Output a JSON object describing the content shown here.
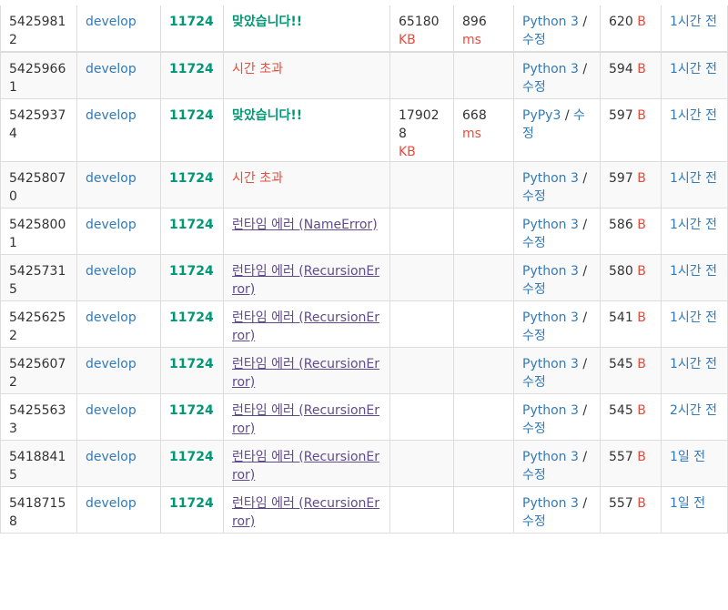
{
  "rows": [
    {
      "id": "54259812",
      "user": "develop",
      "problem": "11724",
      "result": "맞았습니다!!",
      "result_type": "ac",
      "memory": "65180",
      "memory_unit": "KB",
      "time": "896",
      "time_unit": "ms",
      "lang": "Python 3",
      "edit": "수정",
      "length": "620",
      "length_unit": "B",
      "submitted": "1시간 전"
    },
    {
      "id": "54259661",
      "user": "develop",
      "problem": "11724",
      "result": "시간 초과",
      "result_type": "tle",
      "memory": "",
      "memory_unit": "",
      "time": "",
      "time_unit": "",
      "lang": "Python 3",
      "edit": "수정",
      "length": "594",
      "length_unit": "B",
      "submitted": "1시간 전"
    },
    {
      "id": "54259374",
      "user": "develop",
      "problem": "11724",
      "result": "맞았습니다!!",
      "result_type": "ac",
      "memory": "179028",
      "memory_unit": "KB",
      "time": "668",
      "time_unit": "ms",
      "lang": "PyPy3",
      "edit": "수정",
      "length": "597",
      "length_unit": "B",
      "submitted": "1시간 전"
    },
    {
      "id": "54258070",
      "user": "develop",
      "problem": "11724",
      "result": "시간 초과",
      "result_type": "tle",
      "memory": "",
      "memory_unit": "",
      "time": "",
      "time_unit": "",
      "lang": "Python 3",
      "edit": "수정",
      "length": "597",
      "length_unit": "B",
      "submitted": "1시간 전"
    },
    {
      "id": "54258001",
      "user": "develop",
      "problem": "11724",
      "result": "런타임 에러 (NameError)",
      "result_type": "rte",
      "memory": "",
      "memory_unit": "",
      "time": "",
      "time_unit": "",
      "lang": "Python 3",
      "edit": "수정",
      "length": "586",
      "length_unit": "B",
      "submitted": "1시간 전"
    },
    {
      "id": "54257315",
      "user": "develop",
      "problem": "11724",
      "result": "런타임 에러 (RecursionError)",
      "result_type": "rte",
      "memory": "",
      "memory_unit": "",
      "time": "",
      "time_unit": "",
      "lang": "Python 3",
      "edit": "수정",
      "length": "580",
      "length_unit": "B",
      "submitted": "1시간 전"
    },
    {
      "id": "54256252",
      "user": "develop",
      "problem": "11724",
      "result": "런타임 에러 (RecursionError)",
      "result_type": "rte",
      "memory": "",
      "memory_unit": "",
      "time": "",
      "time_unit": "",
      "lang": "Python 3",
      "edit": "수정",
      "length": "541",
      "length_unit": "B",
      "submitted": "1시간 전"
    },
    {
      "id": "54256072",
      "user": "develop",
      "problem": "11724",
      "result": "런타임 에러 (RecursionError)",
      "result_type": "rte",
      "memory": "",
      "memory_unit": "",
      "time": "",
      "time_unit": "",
      "lang": "Python 3",
      "edit": "수정",
      "length": "545",
      "length_unit": "B",
      "submitted": "1시간 전"
    },
    {
      "id": "54255633",
      "user": "develop",
      "problem": "11724",
      "result": "런타임 에러 (RecursionError)",
      "result_type": "rte",
      "memory": "",
      "memory_unit": "",
      "time": "",
      "time_unit": "",
      "lang": "Python 3",
      "edit": "수정",
      "length": "545",
      "length_unit": "B",
      "submitted": "2시간 전"
    },
    {
      "id": "54188415",
      "user": "develop",
      "problem": "11724",
      "result": "런타임 에러 (RecursionError)",
      "result_type": "rte",
      "memory": "",
      "memory_unit": "",
      "time": "",
      "time_unit": "",
      "lang": "Python 3",
      "edit": "수정",
      "length": "557",
      "length_unit": "B",
      "submitted": "1일 전"
    },
    {
      "id": "54187158",
      "user": "develop",
      "problem": "11724",
      "result": "런타임 에러 (RecursionError)",
      "result_type": "rte",
      "memory": "",
      "memory_unit": "",
      "time": "",
      "time_unit": "",
      "lang": "Python 3",
      "edit": "수정",
      "length": "557",
      "length_unit": "B",
      "submitted": "1일 전"
    }
  ],
  "colors": {
    "accepted": "#009874",
    "error": "#e74c3c",
    "runtime": "#5f4b8b",
    "link": "#337ab7"
  }
}
